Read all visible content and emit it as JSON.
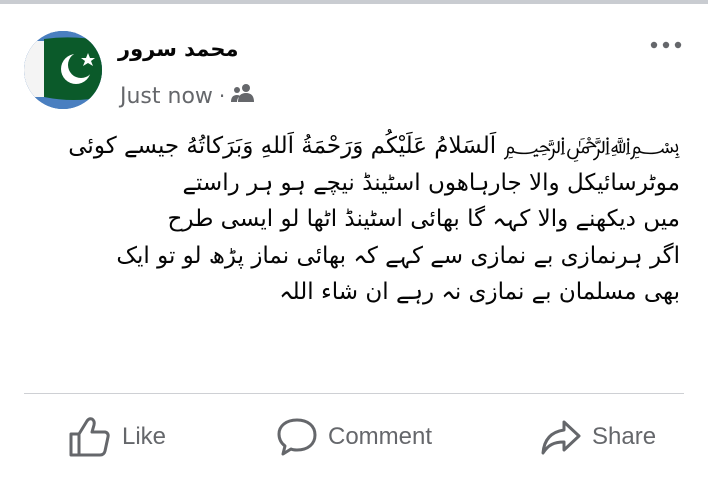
{
  "post": {
    "author": "محمد سرور",
    "timestamp": "Just now",
    "separator": "·",
    "audience_icon": "friends-icon",
    "more_icon": "more-horizontal-icon",
    "text_lines": [
      "﷽ اَلسَلامُ عَلَيْكُم وَرَحْمَةُ اَللهِ وَبَرَكاتُهُ   جیسے کوئی",
      "موٹرسائیکل  والا جارہاھوں اسٹینڈ نیچے ہو    ہر راستے",
      "میں دیکھنے والا کہہ گا بھائی اسٹینڈ  اٹھا لو   ایسی طرح",
      "اگر ہرنمازی  بے نمازی سے کہے کہ بھائی نماز پڑھ لو تو ایک",
      "بھی مسلمان بے نمازی نہ رہے   ان شاء اللہ"
    ]
  },
  "actions": {
    "like_label": "Like",
    "comment_label": "Comment",
    "share_label": "Share"
  },
  "colors": {
    "secondary_text": "#65676b",
    "divider": "#ced0d4",
    "flag_green": "#0b5a2a"
  }
}
